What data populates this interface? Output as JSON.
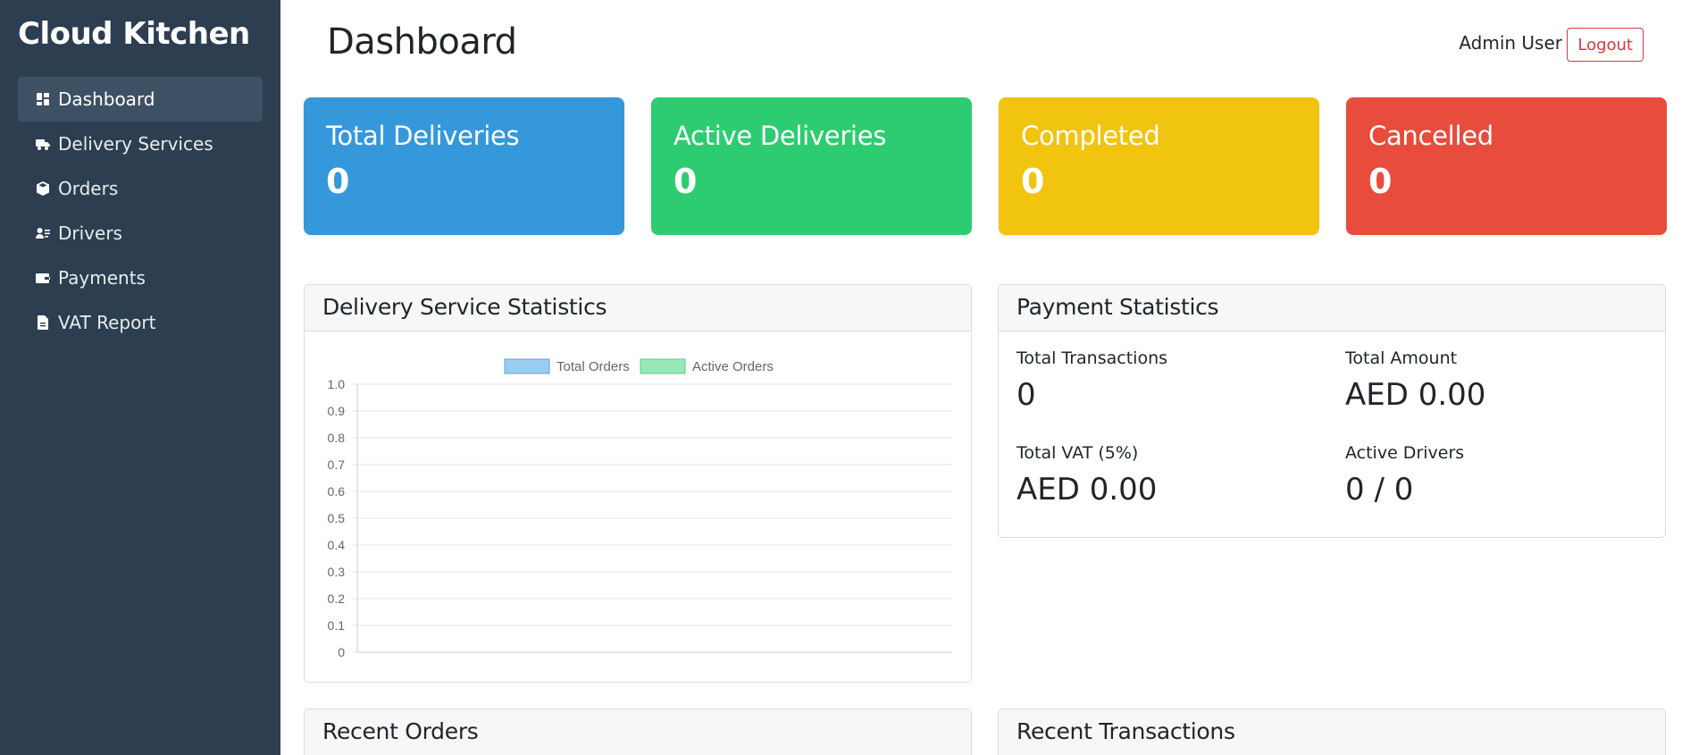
{
  "sidebar": {
    "brand": "Cloud Kitchen",
    "items": [
      {
        "label": "Dashboard",
        "icon": "dashboard-icon",
        "active": true
      },
      {
        "label": "Delivery Services",
        "icon": "truck-icon"
      },
      {
        "label": "Orders",
        "icon": "box-icon"
      },
      {
        "label": "Drivers",
        "icon": "person-badge-icon"
      },
      {
        "label": "Payments",
        "icon": "wallet-icon"
      },
      {
        "label": "VAT Report",
        "icon": "document-icon"
      }
    ]
  },
  "header": {
    "title": "Dashboard",
    "user": "Admin User",
    "logout_label": "Logout"
  },
  "stats": [
    {
      "label": "Total Deliveries",
      "value": "0",
      "color": "#3498db"
    },
    {
      "label": "Active Deliveries",
      "value": "0",
      "color": "#2ecc71"
    },
    {
      "label": "Completed",
      "value": "0",
      "color": "#f1c40f"
    },
    {
      "label": "Cancelled",
      "value": "0",
      "color": "#e74c3c"
    }
  ],
  "delivery_stats": {
    "title": "Delivery Service Statistics"
  },
  "chart_data": {
    "type": "bar",
    "categories": [],
    "series": [
      {
        "name": "Total Orders",
        "values": [],
        "color": "#9ccbf0"
      },
      {
        "name": "Active Orders",
        "values": [],
        "color": "#99e6b7"
      }
    ],
    "ylim": [
      0,
      1.0
    ],
    "yticks": [
      "1.0",
      "0.9",
      "0.8",
      "0.7",
      "0.6",
      "0.5",
      "0.4",
      "0.3",
      "0.2",
      "0.1",
      "0"
    ],
    "grid": true,
    "legend": "top-center"
  },
  "payment_stats": {
    "title": "Payment Statistics",
    "total_transactions_label": "Total Transactions",
    "total_transactions": "0",
    "total_amount_label": "Total Amount",
    "total_amount": "AED 0.00",
    "total_vat_label": "Total VAT (5%)",
    "total_vat": "AED 0.00",
    "active_drivers_label": "Active Drivers",
    "active_drivers": "0 / 0"
  },
  "recent_orders": {
    "title": "Recent Orders"
  },
  "recent_transactions": {
    "title": "Recent Transactions"
  }
}
